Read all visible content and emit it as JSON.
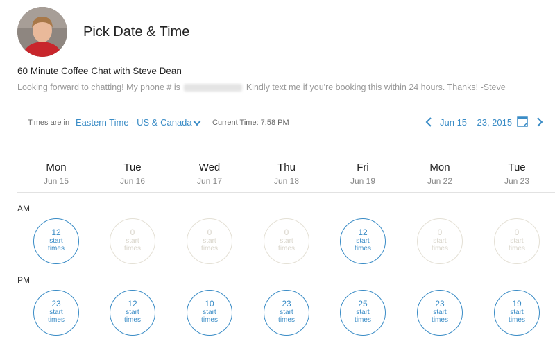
{
  "header": {
    "title": "Pick Date & Time"
  },
  "event": {
    "name": "60 Minute Coffee Chat with Steve Dean",
    "description_before": "Looking forward to chatting! My phone # is",
    "description_after": "Kindly text me if you're booking this within 24 hours. Thanks! -Steve"
  },
  "timezone_bar": {
    "label": "Times are in",
    "selected_zone": "Eastern Time - US & Canada",
    "current_time": "Current Time: 7:58 PM",
    "date_range": "Jun 15 – 23, 2015"
  },
  "periods": {
    "am": "AM",
    "pm": "PM"
  },
  "days": [
    {
      "name": "Mon",
      "date": "Jun 15",
      "am": {
        "count": "12",
        "unit": "start\ntimes",
        "available": true
      },
      "pm": {
        "count": "23",
        "unit": "start\ntimes",
        "available": true
      }
    },
    {
      "name": "Tue",
      "date": "Jun 16",
      "am": {
        "count": "0",
        "unit": "start\ntimes",
        "available": false
      },
      "pm": {
        "count": "12",
        "unit": "start\ntimes",
        "available": true
      }
    },
    {
      "name": "Wed",
      "date": "Jun 17",
      "am": {
        "count": "0",
        "unit": "start\ntimes",
        "available": false
      },
      "pm": {
        "count": "10",
        "unit": "start\ntimes",
        "available": true
      }
    },
    {
      "name": "Thu",
      "date": "Jun 18",
      "am": {
        "count": "0",
        "unit": "start\ntimes",
        "available": false
      },
      "pm": {
        "count": "23",
        "unit": "start\ntimes",
        "available": true
      }
    },
    {
      "name": "Fri",
      "date": "Jun 19",
      "am": {
        "count": "12",
        "unit": "start\ntimes",
        "available": true
      },
      "pm": {
        "count": "25",
        "unit": "start\ntimes",
        "available": true
      }
    },
    {
      "name": "Mon",
      "date": "Jun 22",
      "am": {
        "count": "0",
        "unit": "start\ntimes",
        "available": false
      },
      "pm": {
        "count": "23",
        "unit": "start\ntimes",
        "available": true
      }
    },
    {
      "name": "Tue",
      "date": "Jun 23",
      "am": {
        "count": "0",
        "unit": "start\ntimes",
        "available": false
      },
      "pm": {
        "count": "19",
        "unit": "start\ntimes",
        "available": true
      }
    }
  ],
  "colors": {
    "accent": "#3a8cc6",
    "empty_border": "#e4e0d5",
    "empty_text": "#d9d5cb",
    "muted_text": "#999999"
  },
  "icons": {
    "avatar": "profile-photo",
    "dropdown": "chevron-down-icon",
    "prev": "chevron-left-icon",
    "next": "chevron-right-icon",
    "calendar": "calendar-icon"
  }
}
